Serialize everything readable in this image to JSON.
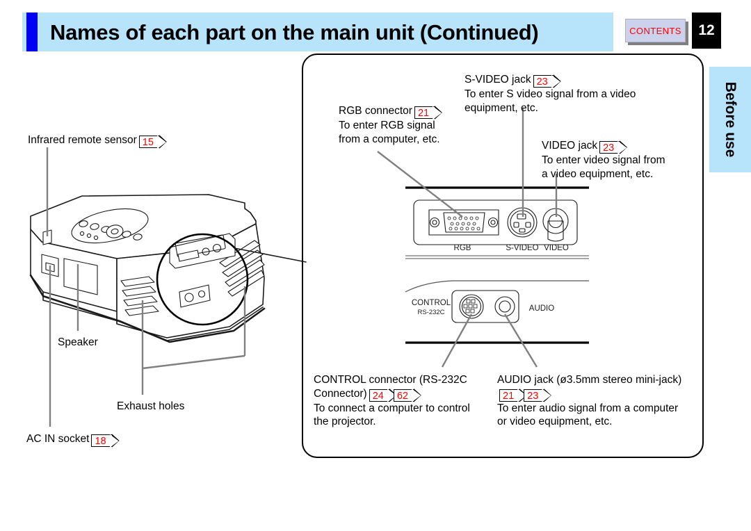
{
  "header": {
    "title": "Names of each part on the main unit (Continued)",
    "contents_label": "CONTENTS",
    "page_number": "12",
    "accent_color": "#0000f2",
    "banner_color": "#b7e3fb",
    "contents_text_color": "#ff0000"
  },
  "side_tab": {
    "label": "Before use",
    "color": "#b7e3fb"
  },
  "callouts": {
    "infrared_sensor": {
      "title": "Infrared remote sensor",
      "refs": [
        "15"
      ],
      "lines": []
    },
    "speaker": {
      "title": "Speaker",
      "refs": [],
      "lines": []
    },
    "exhaust_holes": {
      "title": "Exhaust holes",
      "refs": [],
      "lines": []
    },
    "ac_in_socket": {
      "title": "AC IN socket",
      "refs": [
        "18"
      ],
      "lines": []
    },
    "rgb_connector": {
      "title": "RGB connector",
      "refs": [
        "21"
      ],
      "lines": [
        "To enter RGB signal",
        "from a computer, etc."
      ]
    },
    "svideo_jack": {
      "title": "S-VIDEO jack",
      "refs": [
        "23"
      ],
      "lines": [
        "To enter S video signal from a video",
        "equipment, etc."
      ]
    },
    "video_jack": {
      "title": "VIDEO jack",
      "refs": [
        "23"
      ],
      "lines": [
        "To enter video signal from",
        "a video equipment, etc."
      ]
    },
    "control_connector": {
      "title": "CONTROL connector (RS-232C",
      "title_cont": "Connector)",
      "refs": [
        "24",
        "62"
      ],
      "lines": [
        "To connect a computer to control",
        "the projector."
      ]
    },
    "audio_jack": {
      "title": "AUDIO jack (ø3.5mm stereo mini-jack)",
      "refs": [
        "21",
        "23"
      ],
      "lines": [
        "To enter audio signal from a computer",
        "or video equipment, etc."
      ]
    }
  },
  "panel_labels": {
    "rgb": "RGB",
    "svideo": "S-VIDEO",
    "video": "VIDEO",
    "control": "CONTROL",
    "control_sub": "RS-232C",
    "audio": "AUDIO"
  },
  "colors": {
    "reference_red": "#ff0000",
    "leader_gray": "#808080",
    "line_black": "#000000"
  }
}
